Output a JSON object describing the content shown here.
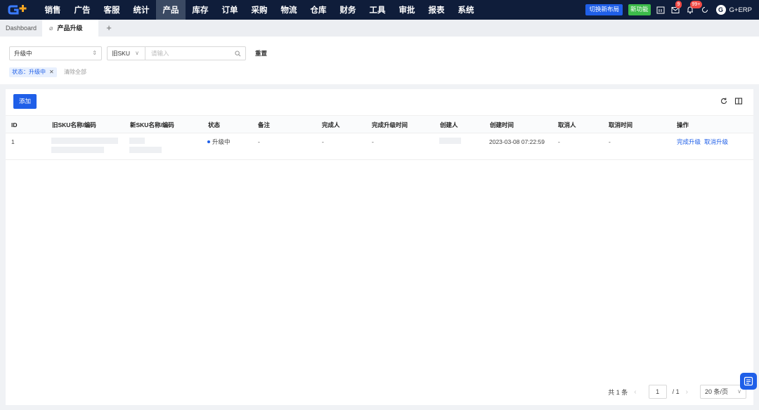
{
  "topnav": {
    "logo_text": "G+",
    "items": [
      "销售",
      "广告",
      "客服",
      "统计",
      "产品",
      "库存",
      "订单",
      "采购",
      "物流",
      "仓库",
      "财务",
      "工具",
      "审批",
      "报表",
      "系统"
    ],
    "active_index": 4,
    "switch_layout_label": "切换新布局",
    "new_feature_label": "新功能",
    "mail_badge": "9",
    "bell_badge": "99+",
    "user_label": "G+ERP",
    "user_avatar": "G"
  },
  "tabs": {
    "dashboard": "Dashboard",
    "active": "产品升级",
    "add": "+"
  },
  "filter": {
    "status_value": "升级中",
    "field_select": "旧SKU",
    "search_placeholder": "请输入",
    "reset_label": "重置",
    "tag_label": "状态：升级中",
    "clear_all_label": "清除全部"
  },
  "toolbar": {
    "add_label": "添加"
  },
  "table": {
    "columns": [
      "ID",
      "旧SKU名称/编码",
      "新SKU名称/编码",
      "状态",
      "备注",
      "完成人",
      "完成升级时间",
      "创建人",
      "创建时间",
      "取消人",
      "取消时间",
      "操作"
    ],
    "rows": [
      {
        "id": "1",
        "status": "升级中",
        "remark": "-",
        "finisher": "-",
        "finish_time": "-",
        "create_time": "2023-03-08 07:22:59",
        "canceler": "-",
        "cancel_time": "-",
        "action_complete": "完成升级",
        "action_cancel": "取消升级"
      }
    ]
  },
  "pagination": {
    "total": "共 1 条",
    "current_page": "1",
    "total_pages": "/ 1",
    "page_size": "20 条/页"
  },
  "colors": {
    "nav_bg": "#0f1d3a",
    "accent": "#1f5fe8",
    "green": "#3cbb4a",
    "badge_red": "#f04b46"
  }
}
